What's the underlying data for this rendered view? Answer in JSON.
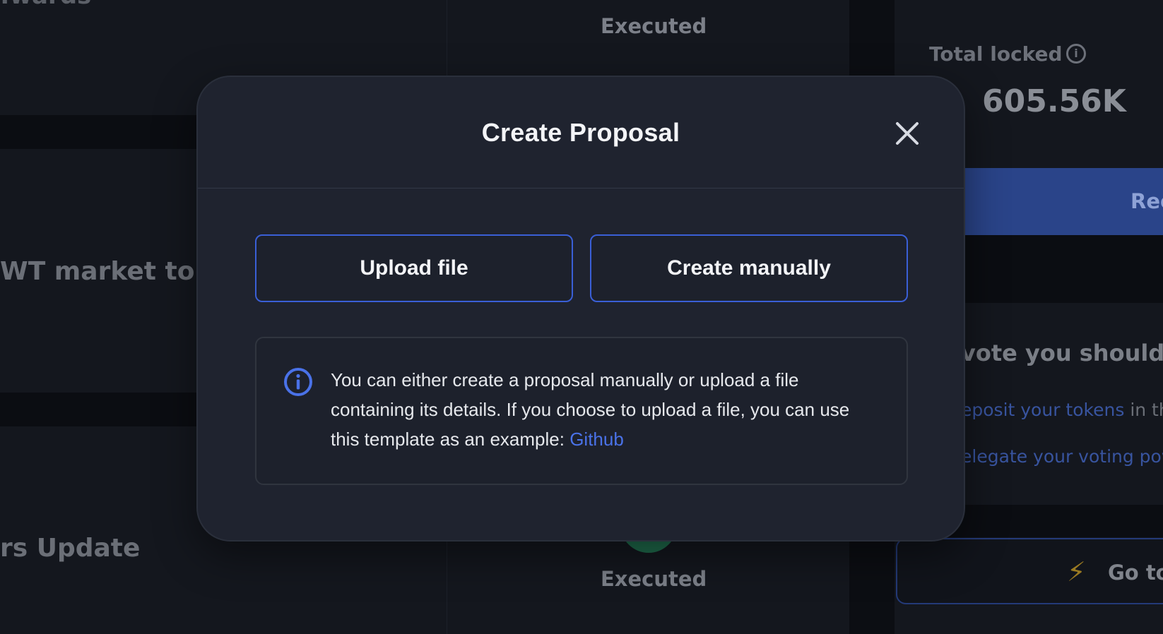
{
  "background": {
    "rewards_fragment": ":wards",
    "market_fragment": "WT market to De",
    "update_fragment": "rs Update",
    "status_top": "Executed",
    "status_bottom": "Executed",
    "total_locked_label": "Total locked",
    "total_locked_value": "605.56K",
    "blue_button_fragment": "Rec",
    "vote_heading_fragment": "vote you should:",
    "deposit_link_fragment": "eposit your tokens",
    "deposit_suffix_fragment": " in the",
    "delegate_link_fragment": "elegate your voting pov",
    "goto_button_fragment": "Go to"
  },
  "modal": {
    "title": "Create Proposal",
    "upload_label": "Upload file",
    "manual_label": "Create manually",
    "info_text": "You can either create a proposal manually or upload a file containing its details. If you choose to upload a file, you can use this template as an example: ",
    "info_link": "Github"
  },
  "colors": {
    "accent": "#3a5fd6",
    "link": "#4a72e8",
    "modal_bg": "#1f232f",
    "page_bg": "#0e1118"
  },
  "icons": {
    "close": "close-icon",
    "info": "info-icon",
    "bolt": "lightning-icon"
  }
}
